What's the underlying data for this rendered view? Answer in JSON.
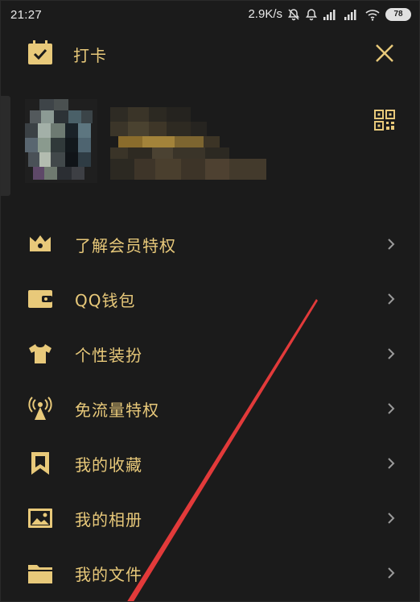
{
  "status_bar": {
    "time": "21:27",
    "net_speed": "2.9K/s",
    "battery": "78"
  },
  "header": {
    "checkin_label": "打卡"
  },
  "menu": {
    "items": [
      {
        "label": "了解会员特权",
        "icon": "crown-icon"
      },
      {
        "label": "QQ钱包",
        "icon": "wallet-icon"
      },
      {
        "label": "个性装扮",
        "icon": "tshirt-icon"
      },
      {
        "label": "免流量特权",
        "icon": "signal-tower-icon"
      },
      {
        "label": "我的收藏",
        "icon": "bookmark-icon"
      },
      {
        "label": "我的相册",
        "icon": "photo-icon"
      },
      {
        "label": "我的文件",
        "icon": "folder-icon"
      }
    ]
  },
  "colors": {
    "accent": "#e8c97a",
    "background": "#1b1b1b",
    "annotation": "#e23a3a"
  }
}
